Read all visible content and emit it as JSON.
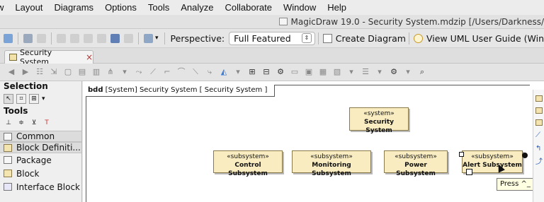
{
  "menu": [
    "w",
    "Layout",
    "Diagrams",
    "Options",
    "Tools",
    "Analyze",
    "Collaborate",
    "Window",
    "Help"
  ],
  "window_title": "MagicDraw 19.0 - Security System.mdzip [/Users/Darkness/",
  "toolbar": {
    "perspective_label": "Perspective:",
    "perspective_value": "Full Featured",
    "create_diagram": "Create Diagram",
    "view_guide": "View UML User Guide (Win"
  },
  "tab": {
    "label": "Security System",
    "close": "×"
  },
  "palette": {
    "selection": "Selection",
    "tools": "Tools",
    "common": "Common",
    "block_definition": "Block Definiti...",
    "items": [
      "Package",
      "Block",
      "Interface Block"
    ]
  },
  "diagram": {
    "frame_kind": "bdd",
    "frame_title": "[System] Security System [ Security System ]",
    "blocks": [
      {
        "stereotype": "«system»",
        "name": "Security System"
      },
      {
        "stereotype": "«subsystem»",
        "name": "Control Subsystem"
      },
      {
        "stereotype": "«subsystem»",
        "name": "Monitoring Subsystem"
      },
      {
        "stereotype": "«subsystem»",
        "name": "Power Subsystem"
      },
      {
        "stereotype": "«subsystem»",
        "name": "Alert Subsystem"
      }
    ],
    "tooltip": "Press ^_ to se"
  },
  "colors": {
    "block_fill": "#f8ecc0",
    "block_border": "#8a7a4a"
  }
}
